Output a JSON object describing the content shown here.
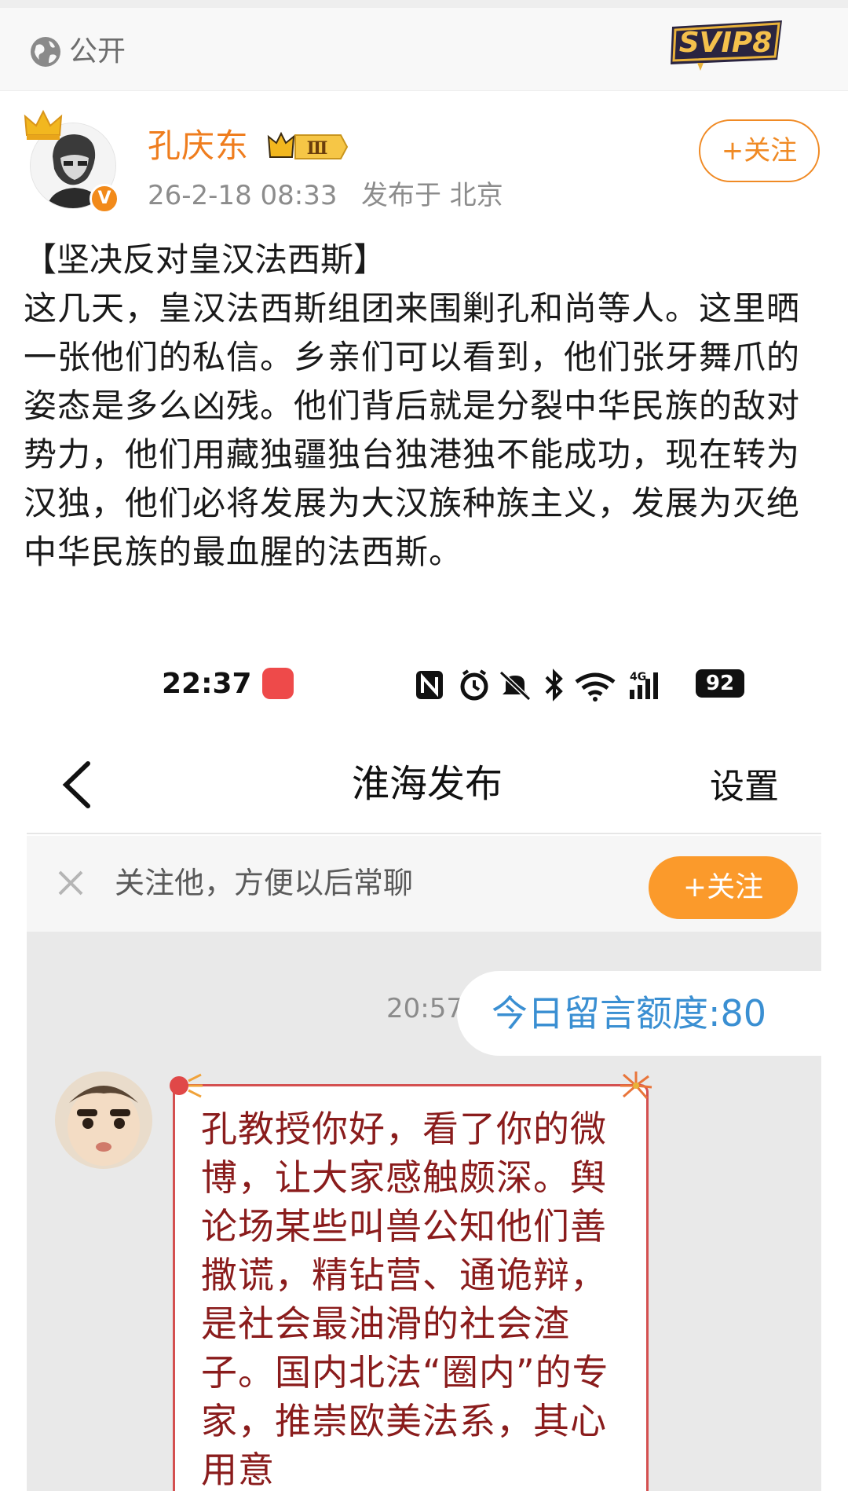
{
  "visibility": {
    "icon": "globe-icon",
    "label": "公开"
  },
  "badge": {
    "text": "SVIP8"
  },
  "author": {
    "name": "孔庆东",
    "level": "Ⅲ",
    "time": "26-2-18 08:33",
    "location": "发布于 北京",
    "verified_mark": "V",
    "follow_label": "+关注"
  },
  "post": {
    "title": "【坚决反对皇汉法西斯】",
    "body": "这几天，皇汉法西斯组团来围剿孔和尚等人。这里晒一张他们的私信。乡亲们可以看到，他们张牙舞爪的姿态是多么凶残。他们背后就是分裂中华民族的敌对势力，他们用藏独疆独台独港独不能成功，现在转为汉独，他们必将发展为大汉族种族主义，发展为灭绝中华民族的最血腥的法西斯。"
  },
  "screenshot": {
    "status_time": "22:37",
    "battery": "92",
    "network": "4G",
    "nav_title": "淮海发布",
    "nav_settings": "设置",
    "prompt_text": "关注他，方便以后常聊",
    "prompt_follow": "+关注",
    "chat_time": "20:57",
    "quota_text": "今日留言额度:80",
    "message": "孔教授你好，看了你的微博，让大家感触颇深。舆论场某些叫兽公知他们善撒谎，精钻营、通诡辩，是社会最油滑的社会渣子。国内北法“圈内”的专家，推崇欧美法系，其心用意"
  },
  "colors": {
    "accent": "#ef7d1e",
    "follow_fill": "#fb9a2b",
    "quota_text": "#3a8fd2",
    "message_text": "#8a1c1c",
    "message_border": "#d45050"
  }
}
